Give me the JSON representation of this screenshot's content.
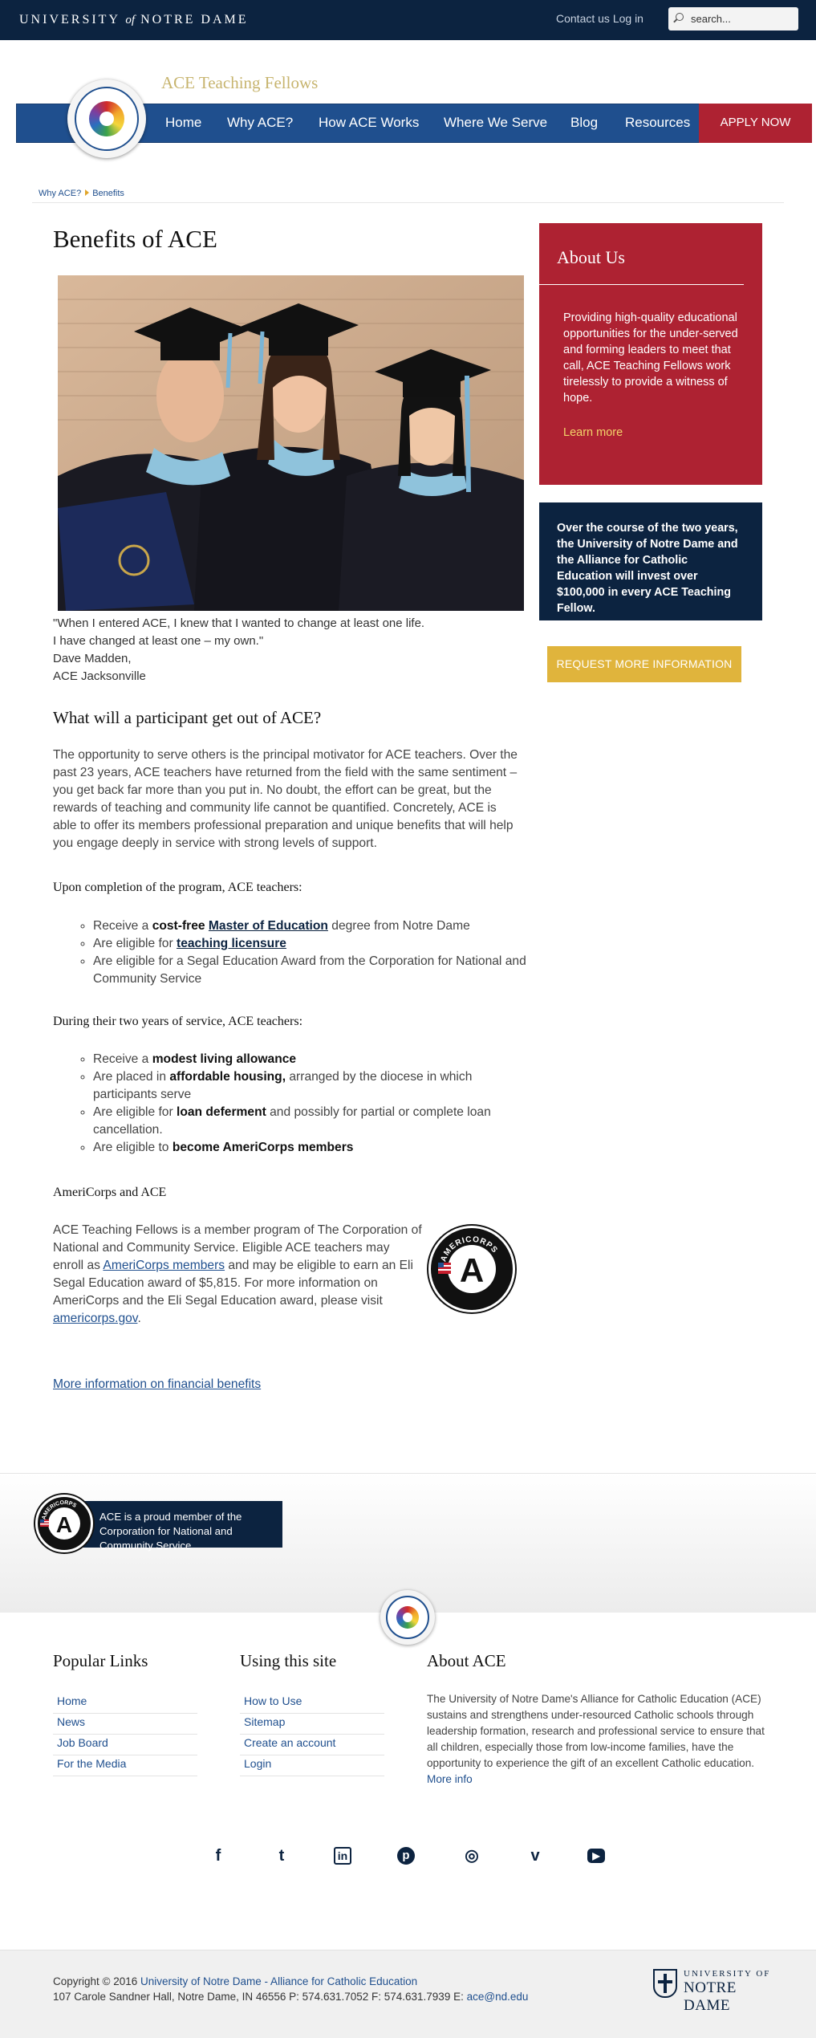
{
  "topbar": {
    "brand_main": "UNIVERSITY",
    "brand_of": "of",
    "brand_end": "NOTRE DAME",
    "contact": "Contact us",
    "login": "Log in",
    "search_placeholder": "search..."
  },
  "header": {
    "site_name": "ACE Teaching Fellows",
    "nav": [
      "Home",
      "Why ACE?",
      "How ACE Works",
      "Where We Serve",
      "Blog",
      "Resources"
    ],
    "apply": "APPLY NOW"
  },
  "breadcrumb": [
    "Why ACE?",
    "Benefits"
  ],
  "main": {
    "title": "Benefits of ACE",
    "quote_lines": [
      "\"When I entered ACE, I knew that I wanted to change at least one life.",
      "I have changed at least one – my own.\"",
      "Dave Madden,",
      "ACE Jacksonville"
    ],
    "section1_title": "What will a participant get out of ACE?",
    "section1_body": "The opportunity to serve others is the principal motivator for ACE teachers. Over the past 23 years, ACE teachers have returned from the field with the same sentiment – you get back far more than you put in. No doubt, the effort can be great, but the rewards of teaching and community life cannot be quantified. Concretely, ACE is able to offer its members professional preparation and unique benefits that will help you engage deeply in service with strong levels of support.",
    "completion_heading": "Upon completion of the program, ACE teachers:",
    "completion": {
      "item1_pre": "Receive a ",
      "item1_bold": "cost-free",
      "item1_link": "Master of Education",
      "item1_post": " degree from Notre Dame",
      "item2_pre": "Are eligible for ",
      "item2_link": "teaching licensure",
      "item3": "Are eligible for a Segal Education Award from the Corporation for National and Community Service"
    },
    "service_heading": "During their two years of service, ACE teachers:",
    "service": {
      "item1_pre": "Receive a ",
      "item1_bold": "modest living allowance",
      "item2_pre": "Are placed in ",
      "item2_bold": "affordable housing,",
      "item2_post": " arranged by the diocese in which participants serve",
      "item3_pre": "Are eligible for ",
      "item3_bold": "loan deferment",
      "item3_post": " and possibly for partial or complete loan cancellation.",
      "item4_pre": "Are eligible to ",
      "item4_bold": "become AmeriCorps members"
    },
    "americorps_heading": "AmeriCorps and ACE",
    "americorps": {
      "p1": "ACE Teaching Fellows is a member program of The Corporation of National and Community Service. Eligible ACE teachers may enroll as ",
      "link1": "AmeriCorps members",
      "p2": " and may be eligible to earn an Eli Segal Education award of $5,815.  For more information on AmeriCorps and the Eli Segal Education award, please visit ",
      "link2": "americorps.gov",
      "p3": ".",
      "logo_text": "AMERICORPS",
      "logo_letter": "A"
    },
    "financial_link": "More information on financial benefits"
  },
  "sidebar": {
    "about_title": "About Us",
    "about_text": "Providing high-quality educational opportunities for the under-served and forming leaders to meet that call, ACE Teaching Fellows work tirelessly to provide a witness of hope.",
    "learn_more": "Learn more",
    "invest_text": "Over the course of the two years, the University of Notre Dame and the Alliance for Catholic Education will invest over $100,000 in every ACE Teaching Fellow.",
    "request_button": "REQUEST MORE INFORMATION"
  },
  "band": {
    "text": "ACE is a proud member of the Corporation for National and Community Service",
    "badge_text": "AMERICORPS",
    "badge_letter": "A"
  },
  "footer": {
    "popular_title": "Popular Links",
    "popular_links": [
      "Home",
      "News",
      "Job Board",
      "For the Media"
    ],
    "using_title": "Using this site",
    "using_links": [
      "How to Use",
      "Sitemap",
      "Create an account",
      "Login"
    ],
    "about_title": "About ACE",
    "about_text": "The University of Notre Dame's Alliance for Catholic Education (ACE) sustains and strengthens under-resourced Catholic schools through leadership formation, research and professional service to ensure that all children, especially those from low-income families, have the opportunity to experience the gift of an excellent Catholic education.",
    "more_info": "More info",
    "social_icons": [
      "facebook-icon",
      "twitter-icon",
      "linkedin-icon",
      "pinterest-icon",
      "instagram-icon",
      "vimeo-icon",
      "youtube-icon"
    ],
    "social_glyphs": [
      "f",
      "t",
      "in",
      "p",
      "◎",
      "v",
      "▶"
    ]
  },
  "bottom": {
    "copyright_pre": "Copyright © 2016 ",
    "copyright_link": "University of Notre Dame - Alliance for Catholic Education",
    "address_pre": "107 Carole Sandner Hall, Notre Dame, IN 46556 P: 574.631.7052 F: 574.631.7939 E: ",
    "email": "ace@nd.edu",
    "nd_logo_top": "UNIVERSITY OF",
    "nd_logo_bottom": "NOTRE DAME"
  },
  "colors": {
    "navy": "#0c2340",
    "nav_blue": "#1f4f8e",
    "ace_red": "#ae2232",
    "gold": "#e0b43c",
    "site_name_gold": "#c7b46e"
  }
}
